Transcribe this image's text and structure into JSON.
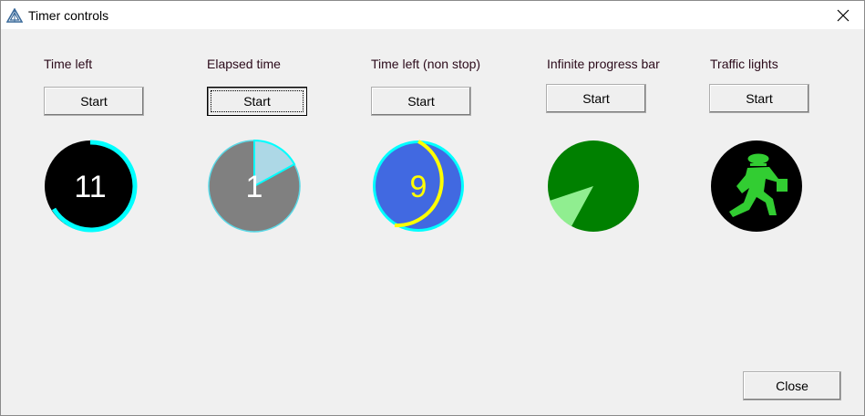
{
  "window": {
    "title": "Timer controls",
    "app_icon": "triangle-logo-icon",
    "close_icon": "close-icon"
  },
  "widgets": [
    {
      "label": "Time left",
      "button": "Start",
      "display": "11",
      "ring_color": "#00ffff",
      "face_color": "#000000",
      "text_color": "#ffffff"
    },
    {
      "label": "Elapsed time",
      "button": "Start",
      "display": "1",
      "face_color": "#808080",
      "slice_color": "#add8e6",
      "text_color": "#ffffff"
    },
    {
      "label": "Time left (non stop)",
      "button": "Start",
      "display": "9",
      "face_color": "#4169e1",
      "ring_color": "#ffff00",
      "text_color": "#ffff00"
    },
    {
      "label": "Infinite progress bar",
      "button": "Start",
      "face_color": "#008000",
      "slice_color": "#90ee90"
    },
    {
      "label": "Traffic lights",
      "button": "Start",
      "face_color": "#000000",
      "figure_color": "#32cd32",
      "icon": "walking-person-icon"
    }
  ],
  "footer": {
    "close_label": "Close"
  }
}
